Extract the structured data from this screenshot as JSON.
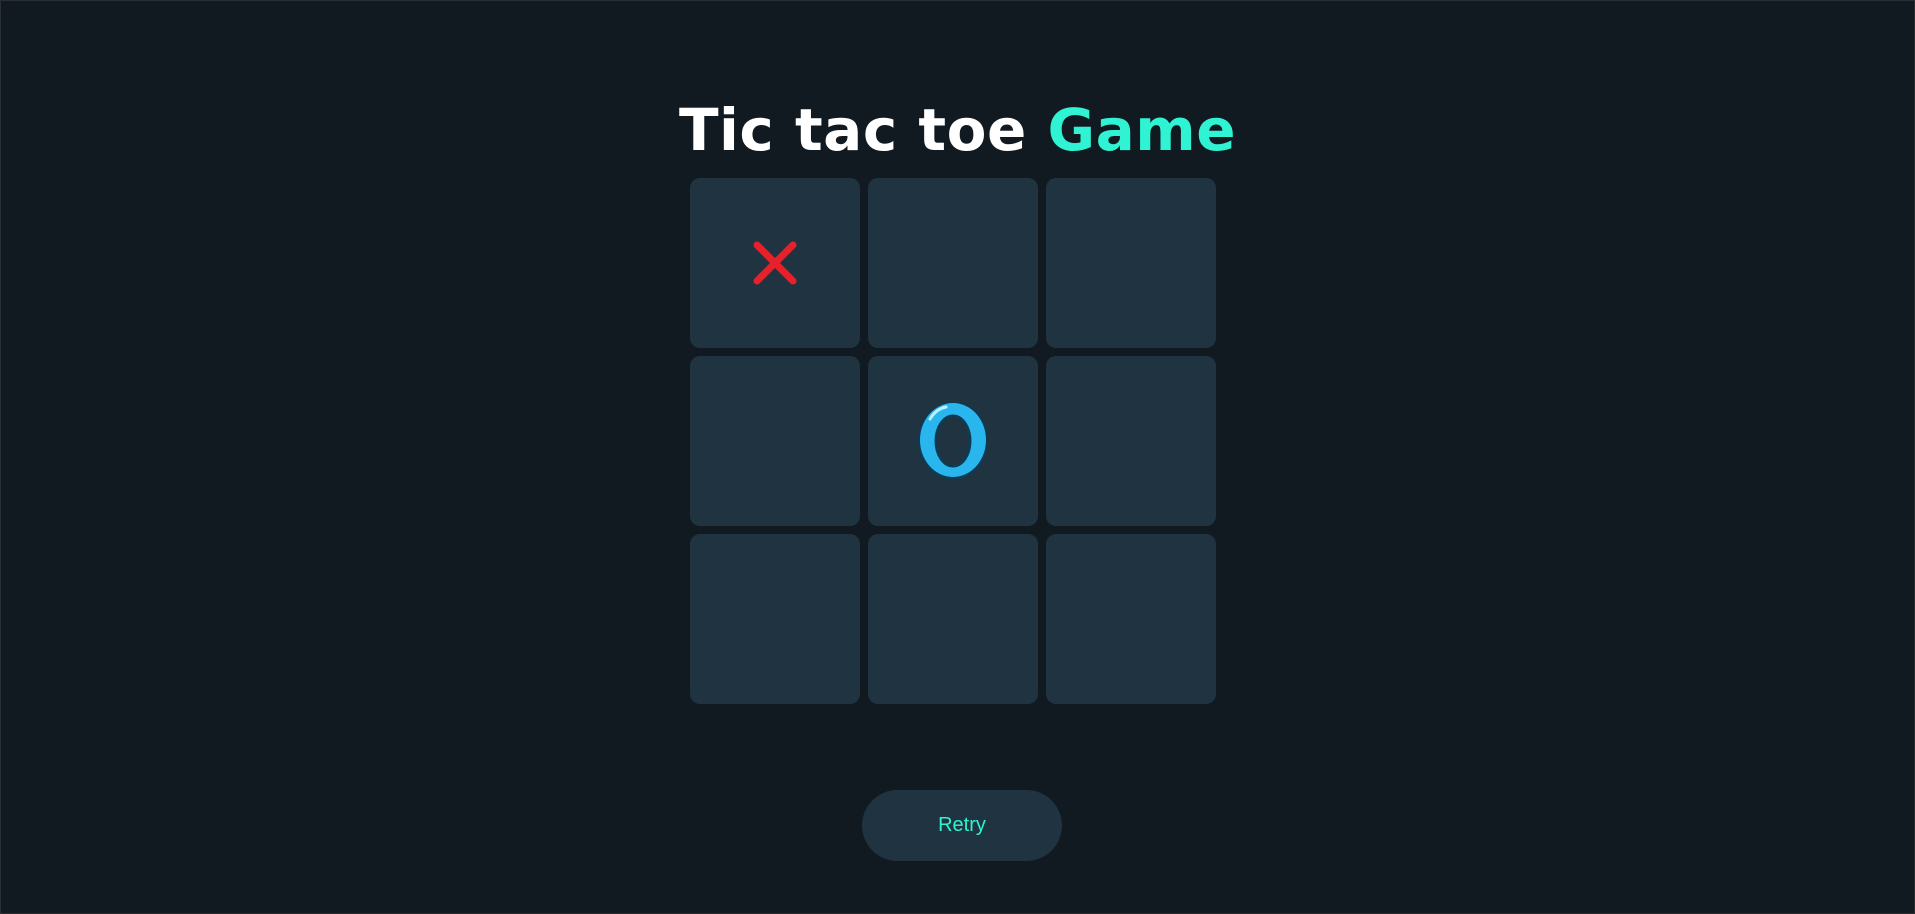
{
  "header": {
    "title_main": "Tic tac toe",
    "title_accent": "Game"
  },
  "board": {
    "cells": [
      "X",
      "",
      "",
      "",
      "O",
      "",
      "",
      "",
      ""
    ]
  },
  "controls": {
    "retry_label": "Retry"
  },
  "colors": {
    "background": "#111a21",
    "cell": "#1f3340",
    "accent": "#2ff3d3",
    "x_mark": "#e8202a",
    "o_mark": "#29b6ee"
  },
  "icons": {
    "x": "x-mark-icon",
    "o": "o-mark-icon"
  }
}
